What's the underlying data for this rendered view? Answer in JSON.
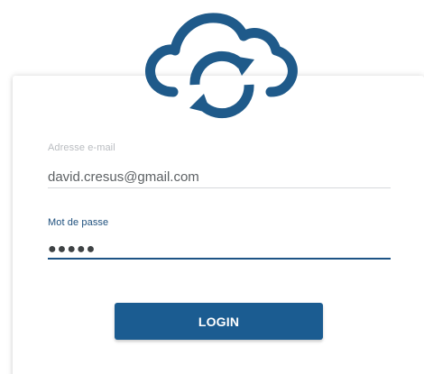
{
  "colors": {
    "brand": "#1b5c91",
    "logo": "#1f5a8a",
    "label_muted": "#b9bcc0",
    "label_active": "#1d4f7d",
    "underline_active": "#1d5385"
  },
  "logo": {
    "icon": "cloud-sync-icon"
  },
  "login_form": {
    "email": {
      "label": "Adresse e-mail",
      "value": "david.cresus@gmail.com"
    },
    "password": {
      "label": "Mot de passe",
      "value": "●●●●●"
    },
    "submit_label": "LOGIN"
  }
}
